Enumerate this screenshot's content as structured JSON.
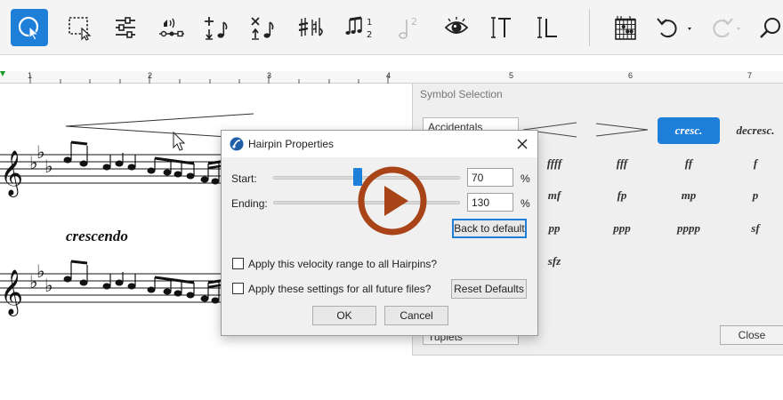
{
  "toolbar": {
    "tools": [
      {
        "name": "selection-tool",
        "active": true
      },
      {
        "name": "marquee-tool"
      },
      {
        "name": "mixer-tool"
      },
      {
        "name": "velocity-tool"
      },
      {
        "name": "add-note-tool"
      },
      {
        "name": "delete-note-tool"
      },
      {
        "name": "accidentals-tool"
      },
      {
        "name": "tuplet-tool"
      },
      {
        "name": "voice-tool"
      },
      {
        "name": "view-tool"
      },
      {
        "name": "text-tool"
      },
      {
        "name": "lyrics-tool"
      },
      {
        "name": "chord-diagram-tool"
      },
      {
        "name": "undo"
      },
      {
        "name": "redo"
      },
      {
        "name": "search"
      }
    ]
  },
  "ruler": {
    "marks": [
      "1",
      "2",
      "3",
      "4",
      "5",
      "6",
      "7"
    ]
  },
  "score": {
    "crescendo_label": "crescendo"
  },
  "symbol_panel": {
    "title": "Symbol Selection",
    "category": "Accidentals",
    "category_bottom": "Tuplets",
    "items": [
      "cresc.",
      "decresc.",
      "ffff",
      "fff",
      "ff",
      "f",
      "mf",
      "fp",
      "mp",
      "p",
      "pp",
      "ppp",
      "pppp",
      "sf",
      "sfz"
    ],
    "selected": "cresc.",
    "close_label": "Close"
  },
  "dialog": {
    "title": "Hairpin Properties",
    "start_label": "Start:",
    "start_value": "70",
    "start_fraction": 0.45,
    "ending_label": "Ending:",
    "ending_value": "130",
    "percent": "%",
    "back_to_default": "Back to default",
    "apply_all_hairpins": "Apply this velocity range to all Hairpins?",
    "apply_future": "Apply these settings for all future files?",
    "reset_defaults": "Reset Defaults",
    "ok_label": "OK",
    "cancel_label": "Cancel"
  },
  "colors": {
    "accent": "#1e7fd8",
    "play_button": "#a94418"
  }
}
